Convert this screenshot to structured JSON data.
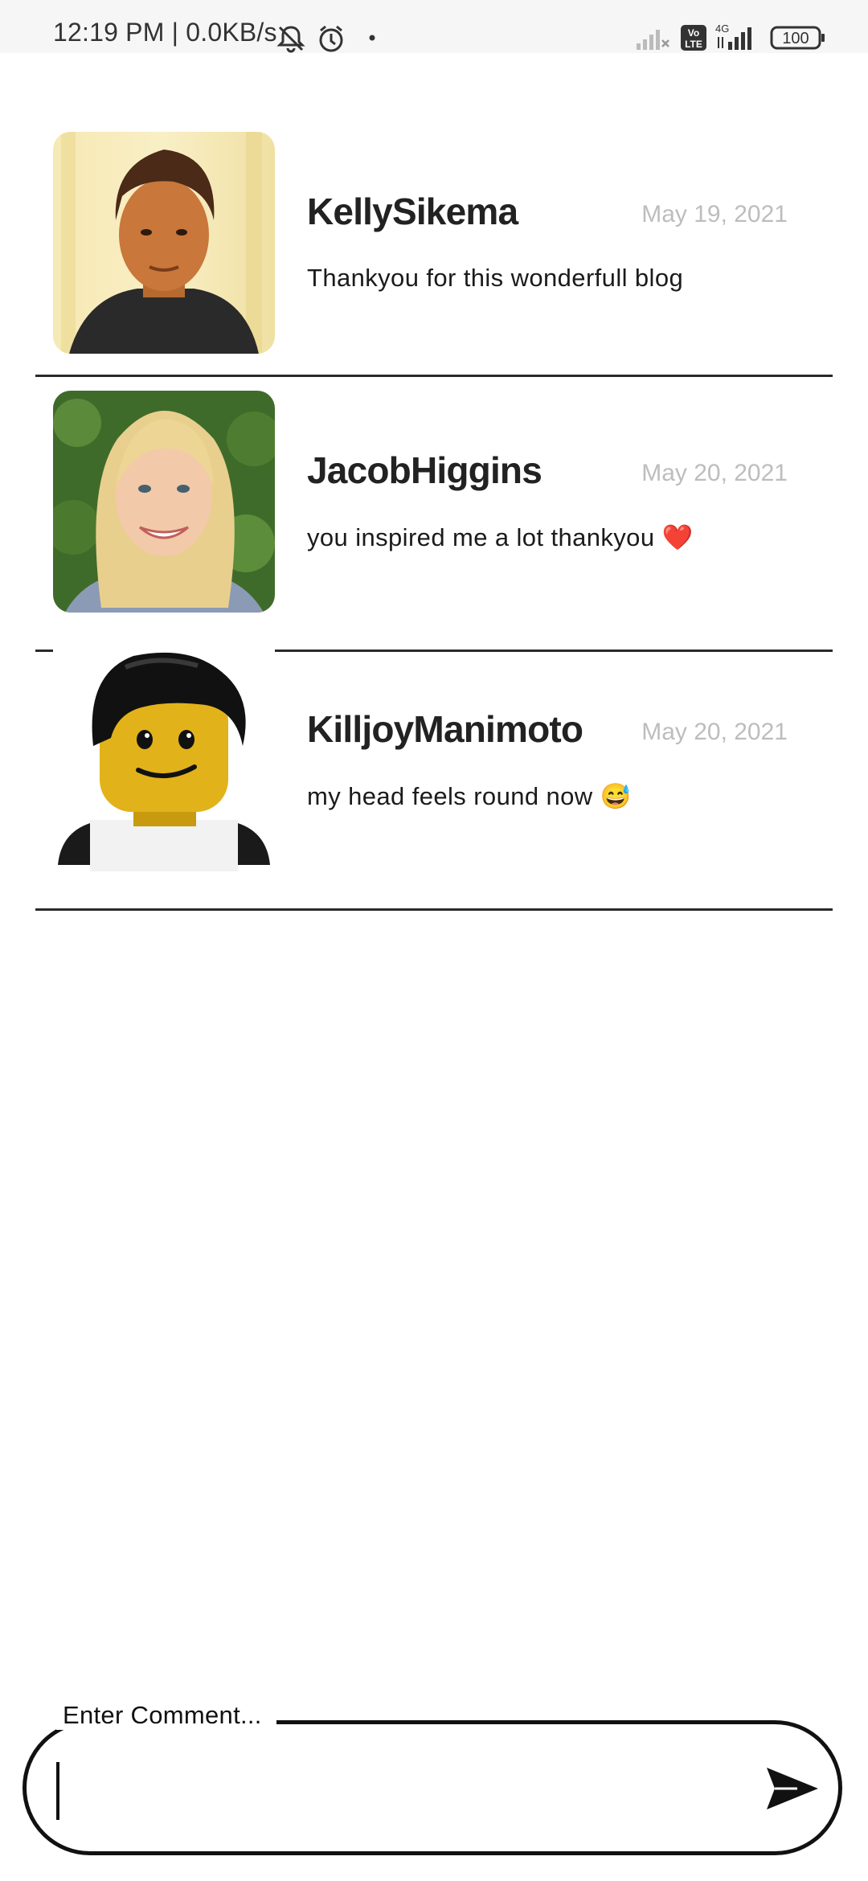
{
  "status_bar": {
    "time_network": "12:19 PM | 0.0KB/s",
    "volte": "Vo\nLTE",
    "network_type": "4G",
    "battery": "100"
  },
  "comments": [
    {
      "username": "KellySikema",
      "date": "May 19, 2021",
      "text": "Thankyou for this wonderfull blog",
      "avatar": "man-photo"
    },
    {
      "username": "JacobHiggins",
      "date": "May 20, 2021",
      "text": "you inspired me a lot thankyou ❤️",
      "avatar": "woman-photo"
    },
    {
      "username": "KilljoyManimoto",
      "date": "May 20, 2021",
      "text": "my head feels round now 😅",
      "avatar": "lego-figure"
    }
  ],
  "comment_input": {
    "label": "Enter Comment...",
    "value": ""
  },
  "icons": {
    "send": "send-icon",
    "mute": "bell-off-icon",
    "alarm": "alarm-icon",
    "signal": "signal-icon",
    "battery": "battery-icon"
  }
}
